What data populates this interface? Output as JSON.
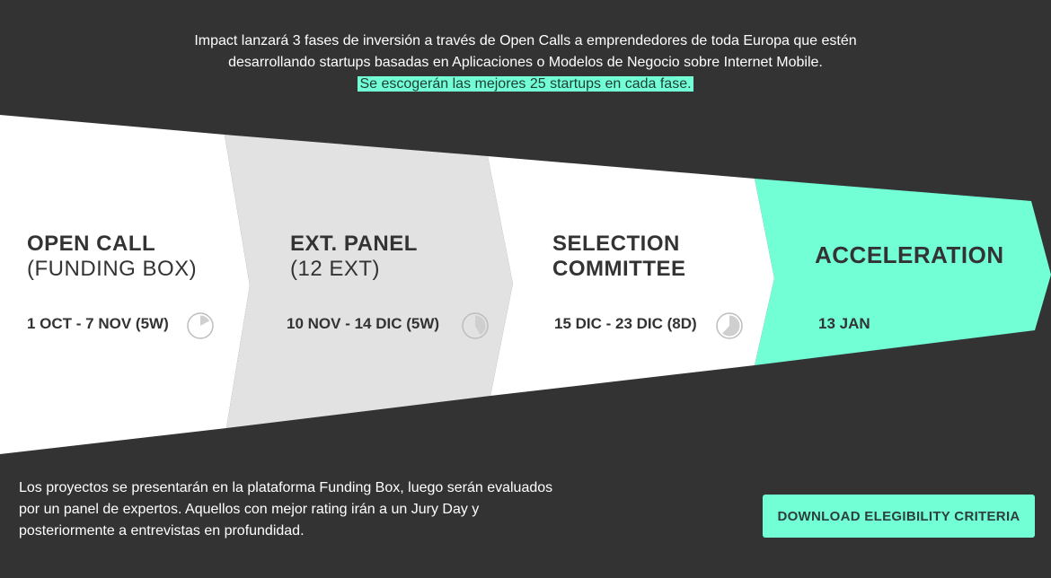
{
  "intro": {
    "line1": "Impact lanzará 3 fases de inversión a través de Open Calls a emprendedores de toda Europa que estén",
    "line2": "desarrollando startups basadas en Aplicaciones o Modelos de Negocio sobre Internet Mobile.",
    "highlight": "Se escogerán las mejores 25 startups en cada fase."
  },
  "phases": [
    {
      "title": "OPEN CALL",
      "subtitle": "(FUNDING BOX)",
      "date": "1 OCT - 7 NOV (5W)",
      "clock_fraction": 0.17,
      "color": "#ffffff"
    },
    {
      "title": "EXT. PANEL",
      "subtitle": "(12 EXT)",
      "date": "10 NOV - 14 DIC (5W)",
      "clock_fraction": 0.42,
      "color": "#e2e2e2"
    },
    {
      "title_line1": "SELECTION",
      "title_line2": "COMMITTEE",
      "date": "15 DIC - 23 DIC (8D)",
      "clock_fraction": 0.62,
      "color": "#ffffff"
    },
    {
      "title": "ACCELERATION",
      "date": "13 JAN",
      "color": "#72ffd6"
    }
  ],
  "description": "Los proyectos se presentarán en la plataforma Funding Box, luego serán evaluados por un panel de expertos. Aquellos con mejor rating irán a un Jury Day y posteriormente a entrevistas en profundidad.",
  "download_button": "DOWNLOAD ELEGIBILITY CRITERIA",
  "colors": {
    "background": "#333333",
    "accent": "#72ffd6",
    "text_dark": "#333333"
  }
}
